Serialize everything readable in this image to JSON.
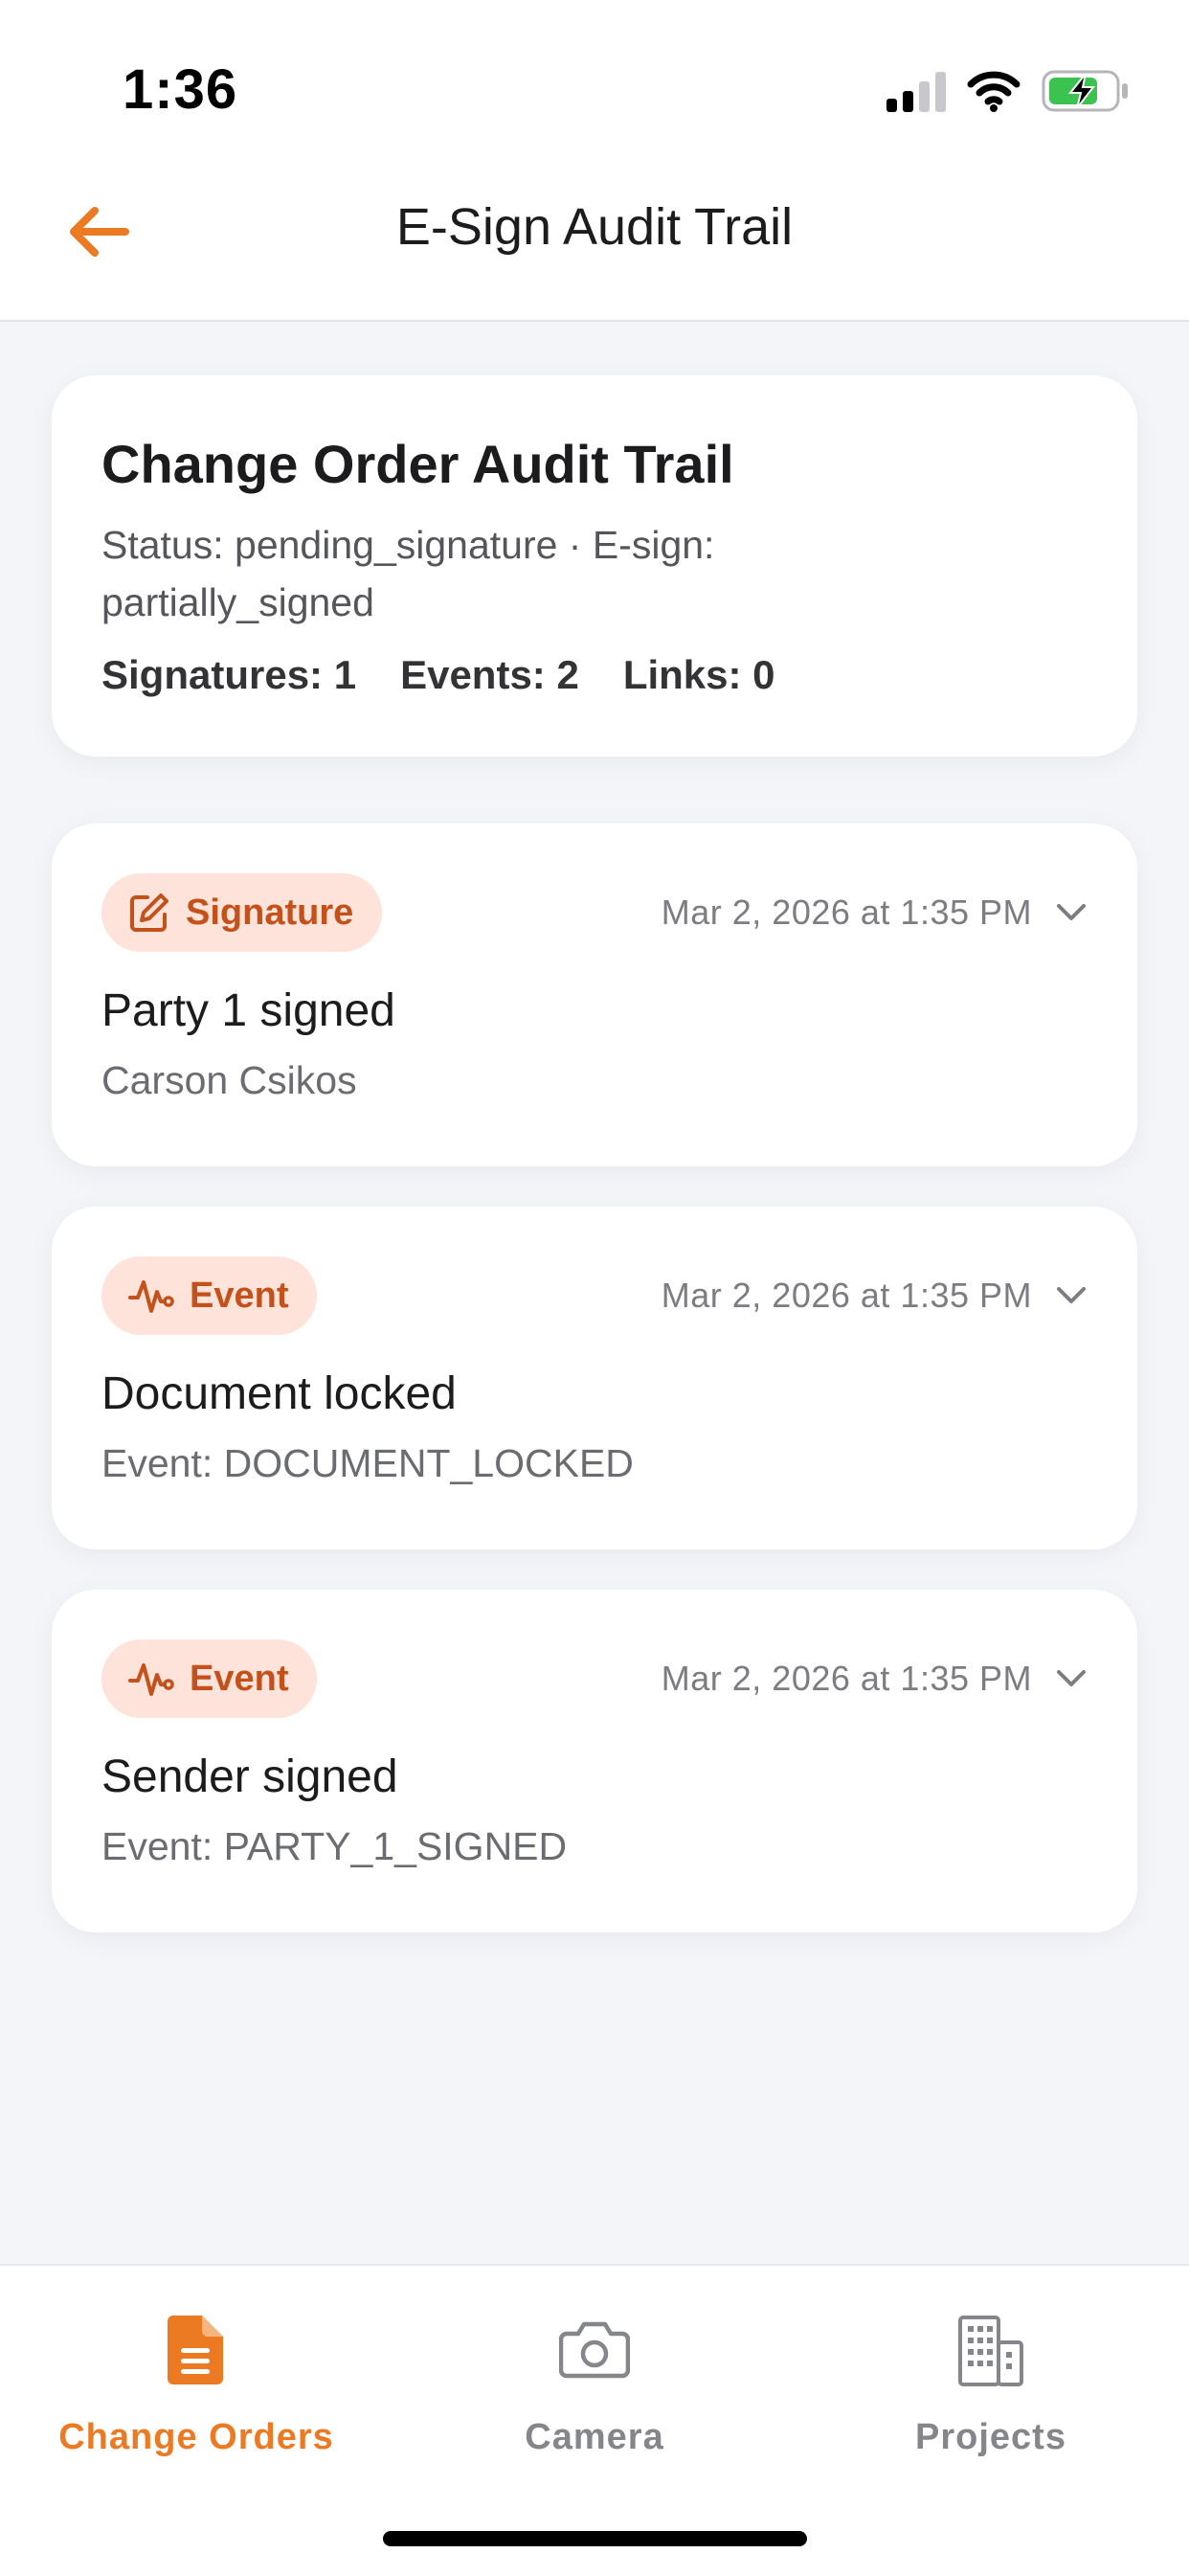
{
  "status_bar": {
    "time": "1:36"
  },
  "header": {
    "title": "E-Sign Audit Trail",
    "accent_color": "#ec7a23"
  },
  "summary": {
    "title": "Change Order Audit Trail",
    "status_line": "Status: pending_signature · E-sign: partially_signed",
    "signatures": "Signatures: 1",
    "events": "Events: 2",
    "links": "Links: 0"
  },
  "entries": [
    {
      "badge": "Signature",
      "badge_icon": "edit-icon",
      "timestamp": "Mar 2, 2026 at 1:35 PM",
      "title": "Party 1 signed",
      "subtitle": "Carson Csikos"
    },
    {
      "badge": "Event",
      "badge_icon": "activity-icon",
      "timestamp": "Mar 2, 2026 at 1:35 PM",
      "title": "Document locked",
      "subtitle": "Event: DOCUMENT_LOCKED"
    },
    {
      "badge": "Event",
      "badge_icon": "activity-icon",
      "timestamp": "Mar 2, 2026 at 1:35 PM",
      "title": "Sender signed",
      "subtitle": "Event: PARTY_1_SIGNED"
    }
  ],
  "tabs": [
    {
      "label": "Change Orders",
      "icon": "document-icon",
      "active": true
    },
    {
      "label": "Camera",
      "icon": "camera-icon",
      "active": false
    },
    {
      "label": "Projects",
      "icon": "building-icon",
      "active": false
    }
  ]
}
